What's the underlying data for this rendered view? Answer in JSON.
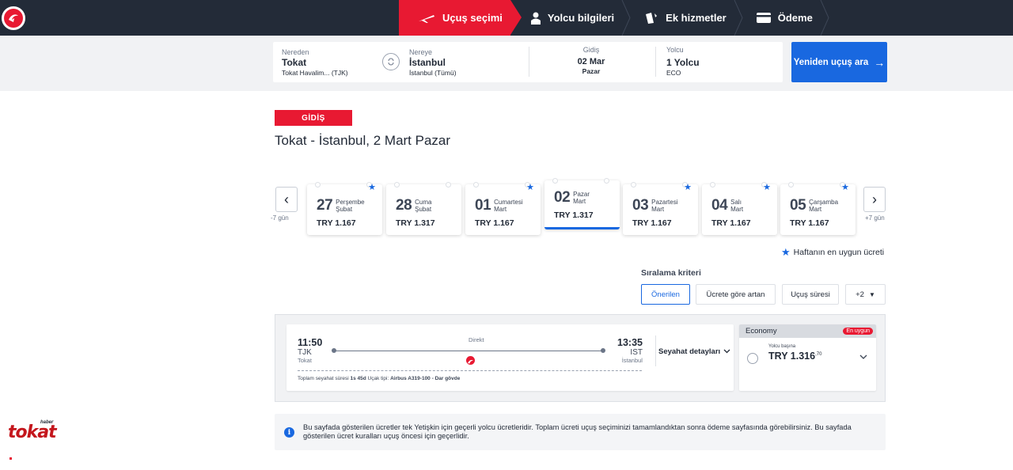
{
  "nav": {
    "steps": [
      {
        "label": "Uçuş seçimi",
        "active": true
      },
      {
        "label": "Yolcu bilgileri",
        "active": false
      },
      {
        "label": "Ek hizmetler",
        "active": false
      },
      {
        "label": "Ödeme",
        "active": false
      }
    ]
  },
  "search": {
    "from_label": "Nereden",
    "from_city": "Tokat",
    "from_airport": "Tokat Havalim... (TJK)",
    "to_label": "Nereye",
    "to_city": "İstanbul",
    "to_airport": "İstanbul (Tümü)",
    "date_label": "Gidiş",
    "date_value": "02 Mar",
    "date_day": "Pazar",
    "pax_label": "Yolcu",
    "pax_value": "1 Yolcu",
    "pax_class": "ECO",
    "button": "Yeniden uçuş ara",
    "button_arrow": "→"
  },
  "heading": {
    "badge": "GİDİŞ",
    "route": "Tokat - İstanbul, 2 Mart Pazar"
  },
  "dates": {
    "prev_label": "-7 gün",
    "next_label": "+7 gün",
    "prev_arrow": "‹",
    "next_arrow": "›",
    "items": [
      {
        "day": "27",
        "weekday": "Perşembe",
        "month": "Şubat",
        "price": "TRY 1.167",
        "star": true
      },
      {
        "day": "28",
        "weekday": "Cuma",
        "month": "Şubat",
        "price": "TRY 1.317",
        "star": false
      },
      {
        "day": "01",
        "weekday": "Cumartesi",
        "month": "Mart",
        "price": "TRY 1.167",
        "star": true
      },
      {
        "day": "02",
        "weekday": "Pazar",
        "month": "Mart",
        "price": "TRY 1.317",
        "star": false
      },
      {
        "day": "03",
        "weekday": "Pazartesi",
        "month": "Mart",
        "price": "TRY 1.167",
        "star": true
      },
      {
        "day": "04",
        "weekday": "Salı",
        "month": "Mart",
        "price": "TRY 1.167",
        "star": true
      },
      {
        "day": "05",
        "weekday": "Çarşamba",
        "month": "Mart",
        "price": "TRY 1.167",
        "star": true
      }
    ],
    "legend": "Haftanın en uygun ücreti"
  },
  "sort": {
    "title": "Sıralama kriteri",
    "options": [
      "Önerilen",
      "Ücrete göre artan",
      "Uçuş süresi",
      "+2"
    ]
  },
  "flight": {
    "dep_time": "11:50",
    "dep_code": "TJK",
    "dep_city": "Tokat",
    "arr_time": "13:35",
    "arr_code": "IST",
    "arr_city": "İstanbul",
    "stop_label": "Direkt",
    "total_label": "Toplam seyahat süresi",
    "total_value": "1s 45d",
    "aircraft_label": "Uçak tipi:",
    "aircraft_value": "Airbus A319-100 - Dar gövde",
    "details": "Seyahat detayları",
    "cabin": "Economy",
    "cabin_tag": "En uygun",
    "per_pax": "Yolcu başına",
    "price": "TRY 1.316",
    "price_cents": ",70"
  },
  "info": {
    "icon": "i",
    "text": "Bu sayfada gösterilen ücretler tek Yetişkin için geçerli yolcu ücretleridir. Toplam ücreti uçuş seçiminizi tamamlandıktan sonra ödeme sayfasında görebilirsiniz. Bu sayfada gösterilen ücret kuralları uçuş öncesi için geçerlidir."
  },
  "watermark": {
    "brand": "tokat",
    "tag": "haber"
  },
  "colors": {
    "brand_red": "#e81932",
    "nav_bg": "#232b38",
    "accent_blue": "#1968e0"
  }
}
